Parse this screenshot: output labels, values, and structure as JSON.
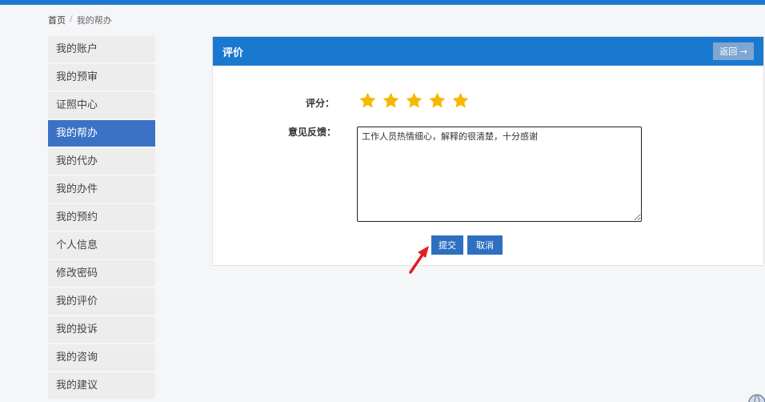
{
  "breadcrumb": {
    "home": "首页",
    "separator": "/",
    "current": "我的帮办"
  },
  "sidebar": {
    "items": [
      {
        "label": "我的账户"
      },
      {
        "label": "我的预审"
      },
      {
        "label": "证照中心"
      },
      {
        "label": "我的帮办",
        "active": true
      },
      {
        "label": "我的代办"
      },
      {
        "label": "我的办件"
      },
      {
        "label": "我的预约"
      },
      {
        "label": "个人信息"
      },
      {
        "label": "修改密码"
      },
      {
        "label": "我的评价"
      },
      {
        "label": "我的投诉"
      },
      {
        "label": "我的咨询"
      },
      {
        "label": "我的建议"
      }
    ]
  },
  "panel": {
    "title": "评价",
    "back_label": "返回 →",
    "rating_label": "评分：",
    "rating": {
      "value": 5,
      "max": 5
    },
    "feedback_label": "意见反馈：",
    "feedback_value": "工作人员热情细心，解释的很清楚，十分感谢",
    "submit_label": "提交",
    "cancel_label": "取消"
  },
  "colors": {
    "primary": "#1979d1",
    "active_nav": "#3b72c6",
    "star": "#f5b800",
    "arrow": "#e02020"
  },
  "icons": [
    "star-icon",
    "arrow-icon",
    "globe-icon"
  ]
}
